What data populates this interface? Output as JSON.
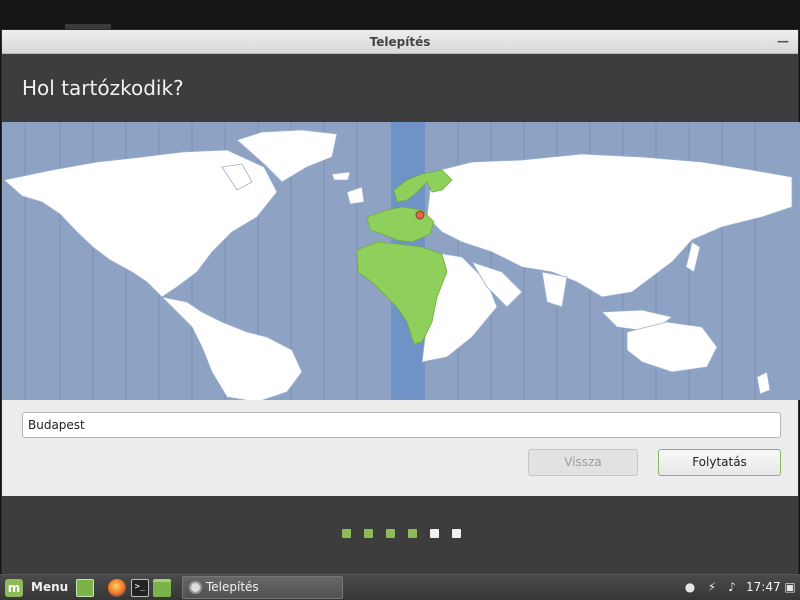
{
  "window": {
    "title": "Telepítés"
  },
  "page": {
    "heading": "Hol tartózkodik?"
  },
  "map": {
    "land_color": "#ffffff",
    "ocean_color": "#8ea3c4",
    "highlight_zone_color": "#6f93c7",
    "highlight_land_color": "#8fcf5b",
    "pin_color": "#e5674b"
  },
  "timezone_field": {
    "value": "Budapest"
  },
  "buttons": {
    "back_label": "Vissza",
    "next_label": "Folytatás"
  },
  "progress": {
    "current_step": 4,
    "total_steps": 6
  },
  "taskbar": {
    "menu_label": "Menu",
    "window_task_label": "Telepítés",
    "clock": "17:47"
  },
  "colors": {
    "accent_green": "#8dbb5a",
    "dark_header": "#3d3d3d",
    "controls_background": "#ececec"
  }
}
